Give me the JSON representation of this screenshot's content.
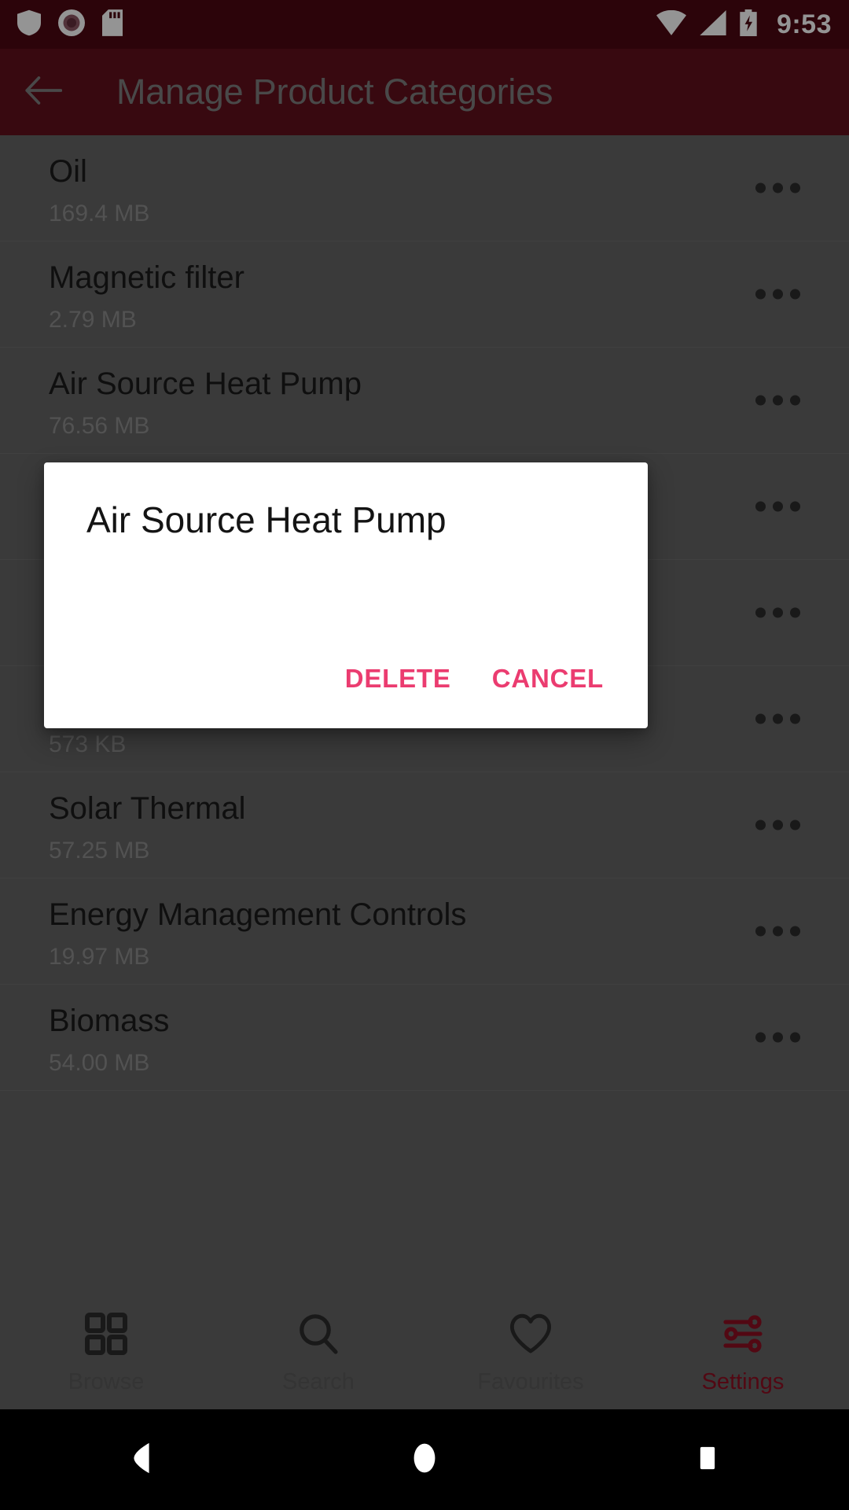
{
  "theme": {
    "status_bar_bg": "#4C0812",
    "app_bar_bg": "#61101C",
    "accent_pink": "#EB3C70",
    "accent_maroon": "#8E0E22",
    "list_bg": "#646464",
    "dialog_bg": "#FFFFFF"
  },
  "status_bar": {
    "clock": "9:53",
    "icons_left": [
      "shield-icon",
      "recording-icon",
      "sd-card-icon"
    ],
    "icons_right": [
      "wifi-icon",
      "cellular-signal-icon",
      "battery-charging-icon"
    ]
  },
  "app_bar": {
    "back_icon": "arrow-back-icon",
    "title": "Manage Product Categories"
  },
  "list": {
    "overflow_icon": "more-options-icon",
    "rows": [
      {
        "title": "Oil",
        "size": "169.4 MB"
      },
      {
        "title": "Magnetic filter",
        "size": "2.79 MB"
      },
      {
        "title": "Air Source Heat Pump",
        "size": "76.56 MB"
      },
      {
        "title": "",
        "size": ""
      },
      {
        "title": "",
        "size": ""
      },
      {
        "title": "",
        "size": "573 KB"
      },
      {
        "title": "Solar Thermal",
        "size": "57.25 MB"
      },
      {
        "title": "Energy Management Controls",
        "size": "19.97 MB"
      },
      {
        "title": "Biomass",
        "size": "54.00 MB"
      }
    ]
  },
  "dialog": {
    "title": "Air Source Heat Pump",
    "delete_label": "DELETE",
    "cancel_label": "CANCEL"
  },
  "bottom_nav": {
    "items": [
      {
        "label": "Browse",
        "icon": "grid-icon",
        "active": false
      },
      {
        "label": "Search",
        "icon": "search-icon",
        "active": false
      },
      {
        "label": "Favourites",
        "icon": "heart-icon",
        "active": false
      },
      {
        "label": "Settings",
        "icon": "sliders-icon",
        "active": true
      }
    ]
  },
  "system_nav": {
    "back": "back-triangle-icon",
    "home": "home-circle-icon",
    "recents": "recents-square-icon"
  }
}
